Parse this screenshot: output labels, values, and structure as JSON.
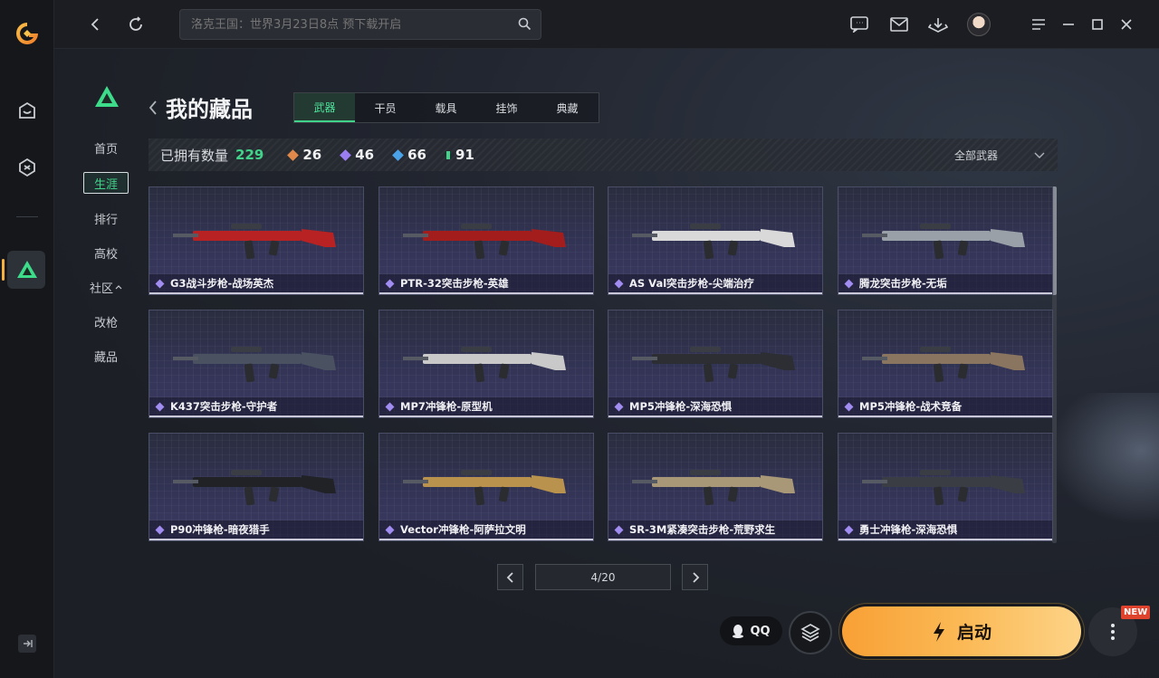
{
  "search": {
    "placeholder": "洛克王国：世界3月23日8点 预下载开启"
  },
  "page": {
    "title": "我的藏品"
  },
  "subnav": [
    "首页",
    "生涯",
    "排行",
    "高校",
    "社区",
    "改枪",
    "藏品"
  ],
  "subnav_active": "生涯",
  "tabs": [
    "武器",
    "干员",
    "载具",
    "挂饰",
    "典藏"
  ],
  "tabs_active": "武器",
  "stats": {
    "owned_label": "已拥有数量",
    "owned_total": "229",
    "counts": [
      {
        "value": "26",
        "color": "#e0894a"
      },
      {
        "value": "46",
        "color": "#9a7df0"
      },
      {
        "value": "66",
        "color": "#4aa3e8"
      },
      {
        "value": "91",
        "color": "#41d38a"
      }
    ]
  },
  "filter": {
    "label": "全部武器"
  },
  "items": [
    {
      "name": "G3战斗步枪-战场英杰",
      "color": "#b82222"
    },
    {
      "name": "PTR-32突击步枪-英雄",
      "color": "#a41d1d"
    },
    {
      "name": "AS Val突击步枪-尖端治疗",
      "color": "#d9d9d9"
    },
    {
      "name": "腾龙突击步枪-无垢",
      "color": "#9aa0a8"
    },
    {
      "name": "K437突击步枪-守护者",
      "color": "#4a5262"
    },
    {
      "name": "MP7冲锋枪-原型机",
      "color": "#c9c9c9"
    },
    {
      "name": "MP5冲锋枪-深海恐惧",
      "color": "#2c2e33"
    },
    {
      "name": "MP5冲锋枪-战术竞备",
      "color": "#8a7560"
    },
    {
      "name": "P90冲锋枪-暗夜猎手",
      "color": "#202226"
    },
    {
      "name": "Vector冲锋枪-阿萨拉文明",
      "color": "#b9924d"
    },
    {
      "name": "SR-3M紧凑突击步枪-荒野求生",
      "color": "#a89878"
    },
    {
      "name": "勇士冲锋枪-深海恐惧",
      "color": "#3a3d44"
    }
  ],
  "pager": {
    "text": "4/20"
  },
  "footer": {
    "qq_label": "QQ",
    "launch_label": "启动",
    "new_badge": "NEW"
  }
}
